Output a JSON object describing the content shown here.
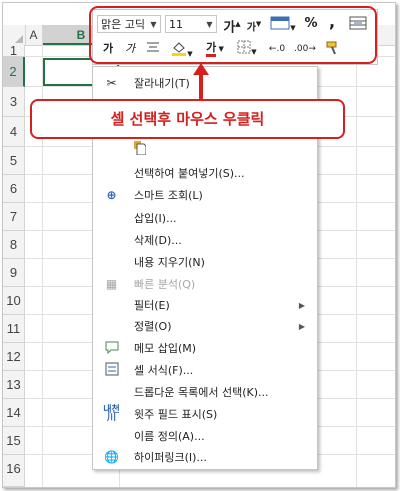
{
  "sheet": {
    "columns": [
      "A",
      "B"
    ],
    "rows": [
      "1",
      "2",
      "3",
      "4",
      "5",
      "6",
      "7",
      "8",
      "9",
      "10",
      "11",
      "12",
      "13",
      "14",
      "15",
      "16"
    ],
    "selected_column": "B",
    "selected_row": "2"
  },
  "mini_toolbar": {
    "font_name": "맑은 고딕",
    "font_size": "11",
    "grow_font": "가",
    "shrink_font": "가",
    "percent": "%",
    "comma": ",",
    "bold": "가",
    "italic": "가",
    "font_color_letter": "가"
  },
  "callout": {
    "text": "셀 선택후 마우스 우클릭"
  },
  "context_menu": {
    "items": [
      {
        "label": "잘라내기(T)",
        "icon": "scissors-icon"
      },
      {
        "label": "선택하여 붙여넣기(S)...",
        "icon": ""
      },
      {
        "label": "스마트 조회(L)",
        "icon": "smart-lookup-icon"
      },
      {
        "label": "삽입(I)...",
        "icon": ""
      },
      {
        "label": "삭제(D)...",
        "icon": ""
      },
      {
        "label": "내용 지우기(N)",
        "icon": ""
      },
      {
        "label": "빠른 분석(Q)",
        "icon": "quick-analysis-icon",
        "disabled": true
      },
      {
        "label": "필터(E)",
        "icon": "",
        "submenu": true
      },
      {
        "label": "정렬(O)",
        "icon": "",
        "submenu": true
      },
      {
        "label": "메모 삽입(M)",
        "icon": "comment-icon"
      },
      {
        "label": "셀 서식(F)...",
        "icon": "format-cells-icon"
      },
      {
        "label": "드롭다운 목록에서 선택(K)...",
        "icon": ""
      },
      {
        "label": "윗주 필드 표시(S)",
        "icon": "phonetic-icon"
      },
      {
        "label": "이름 정의(A)...",
        "icon": ""
      },
      {
        "label": "하이퍼링크(I)...",
        "icon": "hyperlink-icon"
      }
    ]
  },
  "colors": {
    "accent": "#217346",
    "highlight_red": "#d62020"
  }
}
